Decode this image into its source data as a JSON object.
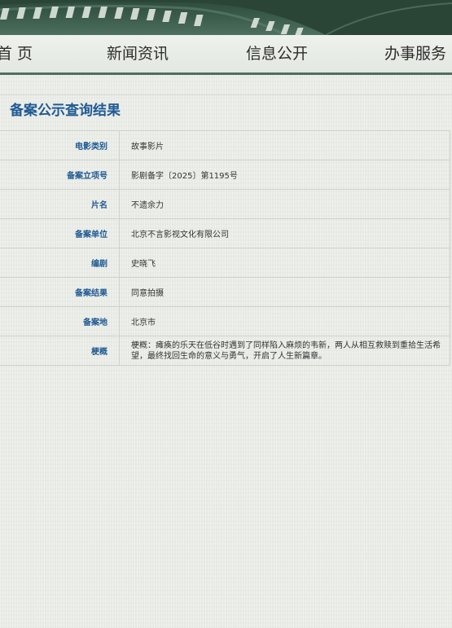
{
  "nav": {
    "items": [
      "首 页",
      "新闻资讯",
      "信息公开",
      "办事服务"
    ]
  },
  "page_title": "备案公示查询结果",
  "table": {
    "rows": [
      {
        "label": "电影类别",
        "value": "故事影片"
      },
      {
        "label": "备案立项号",
        "value": "影剧备字〔2025〕第1195号"
      },
      {
        "label": "片名",
        "value": "不遗余力"
      },
      {
        "label": "备案单位",
        "value": "北京不言影视文化有限公司"
      },
      {
        "label": "编剧",
        "value": "史晓飞"
      },
      {
        "label": "备案结果",
        "value": "同意拍摄"
      },
      {
        "label": "备案地",
        "value": "北京市"
      },
      {
        "label": "梗概",
        "value": "梗概：瘫痪的乐天在低谷时遇到了同样陷入麻烦的韦新，两人从相互救赎到重拾生活希望，最终找回生命的意义与勇气，开启了人生新篇章。"
      }
    ]
  },
  "colors": {
    "banner": "#3d5e4c",
    "accent_blue": "#1f5a94",
    "nav_border": "#4f6f5d"
  }
}
